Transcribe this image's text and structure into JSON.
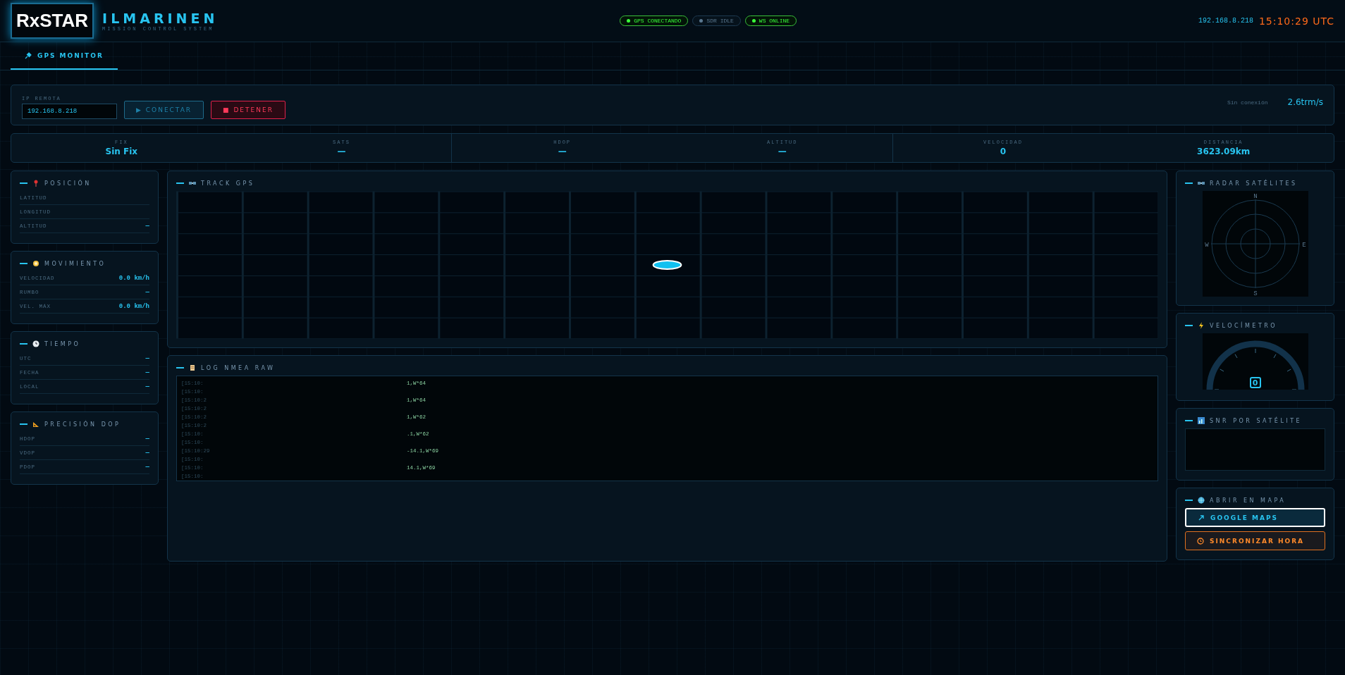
{
  "header": {
    "logo": "RxSTAR",
    "title": "ILMARINEN",
    "subtitle": "MISSION CONTROL SYSTEM",
    "badges": [
      {
        "label": "GPS CONECTANDO",
        "color": "#39ff3a"
      },
      {
        "label": "SDR IDLE",
        "color": "#5a7890"
      },
      {
        "label": "WS ONLINE",
        "color": "#39ff3a"
      }
    ],
    "ip": "192.168.8.218",
    "clock": "15:10:29 UTC"
  },
  "tabs": [
    {
      "label": "GPS MONITOR",
      "selected": true
    }
  ],
  "connection": {
    "field_label": "IP REMOTA",
    "ip_value": "192.168.8.218",
    "buttons": [
      {
        "label": "▶ CONECTAR",
        "kind": "connect"
      },
      {
        "label": "■ DETENER",
        "kind": "stop"
      }
    ],
    "status": "Sin conexión",
    "rate": "2.6trm/s"
  },
  "stats": [
    {
      "label": "FIX",
      "value": "Sin Fix"
    },
    {
      "label": "SATS",
      "value": "—"
    },
    {
      "label": "HDOP",
      "value": "—"
    },
    {
      "label": "ALTITUD",
      "value": "—"
    },
    {
      "label": "VELOCIDAD",
      "value": "0"
    },
    {
      "label": "DISTANCIA",
      "value": "3623.09km"
    }
  ],
  "left_panels": [
    {
      "title": "POSICIÓN",
      "rows": [
        {
          "label": "LATITUD"
        },
        {
          "label": "LONGITUD"
        },
        {
          "label": "ALTITUD",
          "value": "—"
        }
      ]
    },
    {
      "title": "MOVIMIENTO",
      "rows": [
        {
          "label": "VELOCIDAD",
          "value": "0.0 km/h"
        },
        {
          "label": "RUMBO",
          "value": "—"
        },
        {
          "label": "VEL. MÁX",
          "value": "0.0 km/h"
        }
      ]
    },
    {
      "title": "TIEMPO",
      "rows": [
        {
          "label": "UTC",
          "value": "—"
        },
        {
          "label": "FECHA",
          "value": "—"
        },
        {
          "label": "LOCAL",
          "value": "—"
        }
      ]
    },
    {
      "title": "PRECISIÓN DOP",
      "rows": [
        {
          "label": "HDOP",
          "value": "—"
        },
        {
          "label": "VDOP",
          "value": "—"
        },
        {
          "label": "PDOP",
          "value": "—"
        }
      ]
    }
  ],
  "track": {
    "title": "TRACK GPS"
  },
  "log": {
    "title": "LOG NMEA RAW",
    "lines": [
      {
        "time": "[15:10:",
        "tail": "1,W*64"
      },
      {
        "time": "[15:10:"
      },
      {
        "time": "[15:10:2",
        "tail": "1,W*64"
      },
      {
        "time": "[15:10:2"
      },
      {
        "time": "[15:10:2",
        "tail": "1,W*62"
      },
      {
        "time": "[15:10:2"
      },
      {
        "time": "[15:10:",
        "tail": ".1,W*62"
      },
      {
        "time": "[15:10:"
      },
      {
        "time": "[15:10:29",
        "tail": "-14.1,W*69"
      },
      {
        "time": "[15:10:"
      },
      {
        "time": "[15:10:",
        "tail": "14.1,W*69"
      },
      {
        "time": "[15:10:"
      }
    ]
  },
  "radar": {
    "title": "RADAR SATÉLITES",
    "directions": [
      "N",
      "E",
      "S",
      "W"
    ]
  },
  "speedometer": {
    "title": "VELOCÍMETRO",
    "value": "0"
  },
  "snr": {
    "title": "SNR POR SATÉLITE"
  },
  "map": {
    "title": "ABRIR EN MAPA",
    "buttons": [
      {
        "label": "GOOGLE MAPS",
        "kind": "maps",
        "selected": true
      },
      {
        "label": "SINCRONIZAR HORA",
        "kind": "sync",
        "selected": false
      }
    ]
  }
}
